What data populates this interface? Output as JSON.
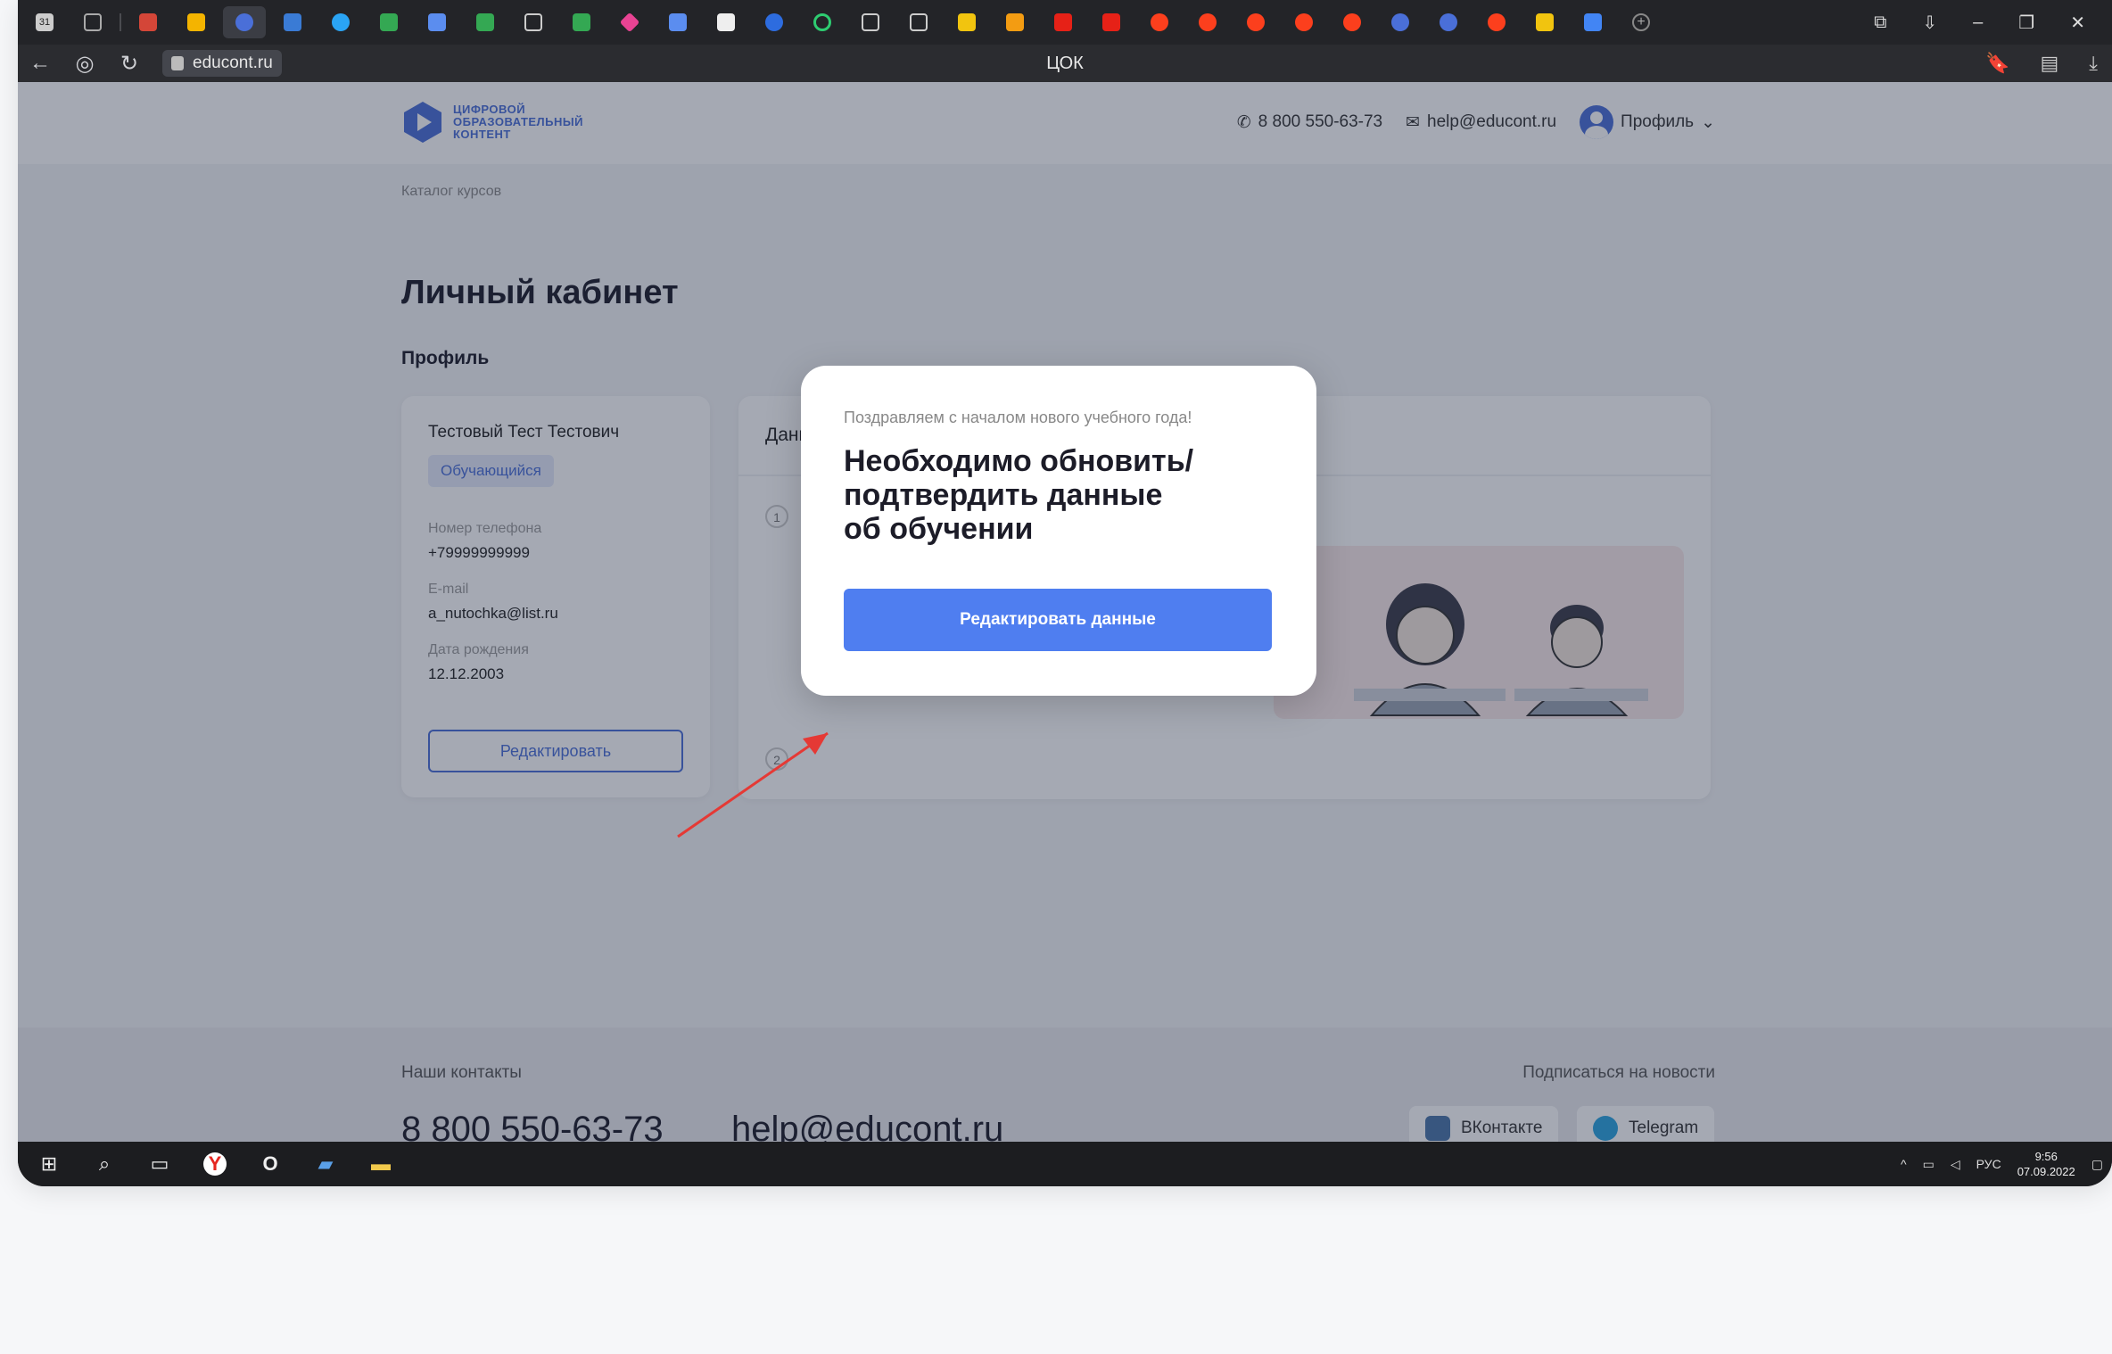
{
  "browser": {
    "url": "educont.ru",
    "page_title": "ЦОК",
    "tab_badge": "31"
  },
  "header": {
    "logo_lines": [
      "ЦИФРОВОЙ",
      "ОБРАЗОВАТЕЛЬНЫЙ",
      "КОНТЕНТ"
    ],
    "phone": "8 800 550-63-73",
    "email": "help@educont.ru",
    "profile_label": "Профиль"
  },
  "breadcrumb": "Каталог курсов",
  "page": {
    "title": "Личный кабинет",
    "subtitle": "Профиль"
  },
  "profile": {
    "name": "Тестовый Тест Тестович",
    "role_badge": "Обучающийся",
    "phone_label": "Номер телефона",
    "phone_value": "+79999999999",
    "email_label": "E-mail",
    "email_value": "a_nutochka@list.ru",
    "birth_label": "Дата рождения",
    "birth_value": "12.12.2003",
    "edit_button": "Редактировать"
  },
  "education": {
    "title": "Данные об обучении",
    "step1": "1",
    "step2": "2"
  },
  "modal": {
    "kicker": "Поздравляем с началом нового учебного года!",
    "headline_lines": [
      "Необходимо обновить/",
      "подтвердить данные",
      "об обучении"
    ],
    "button": "Редактировать данные"
  },
  "footer": {
    "contacts_label": "Наши контакты",
    "phone_big": "8 800 550-63-73",
    "email_big": "help@educont.ru",
    "subscribe_label": "Подписаться на новости",
    "vk": "ВКонтакте",
    "telegram": "Telegram"
  },
  "taskbar": {
    "lang": "РУС",
    "time": "9:56",
    "date": "07.09.2022"
  },
  "colors": {
    "accent": "#4f7ef0",
    "brand": "#4a6fd8",
    "arrow": "#e53935"
  }
}
